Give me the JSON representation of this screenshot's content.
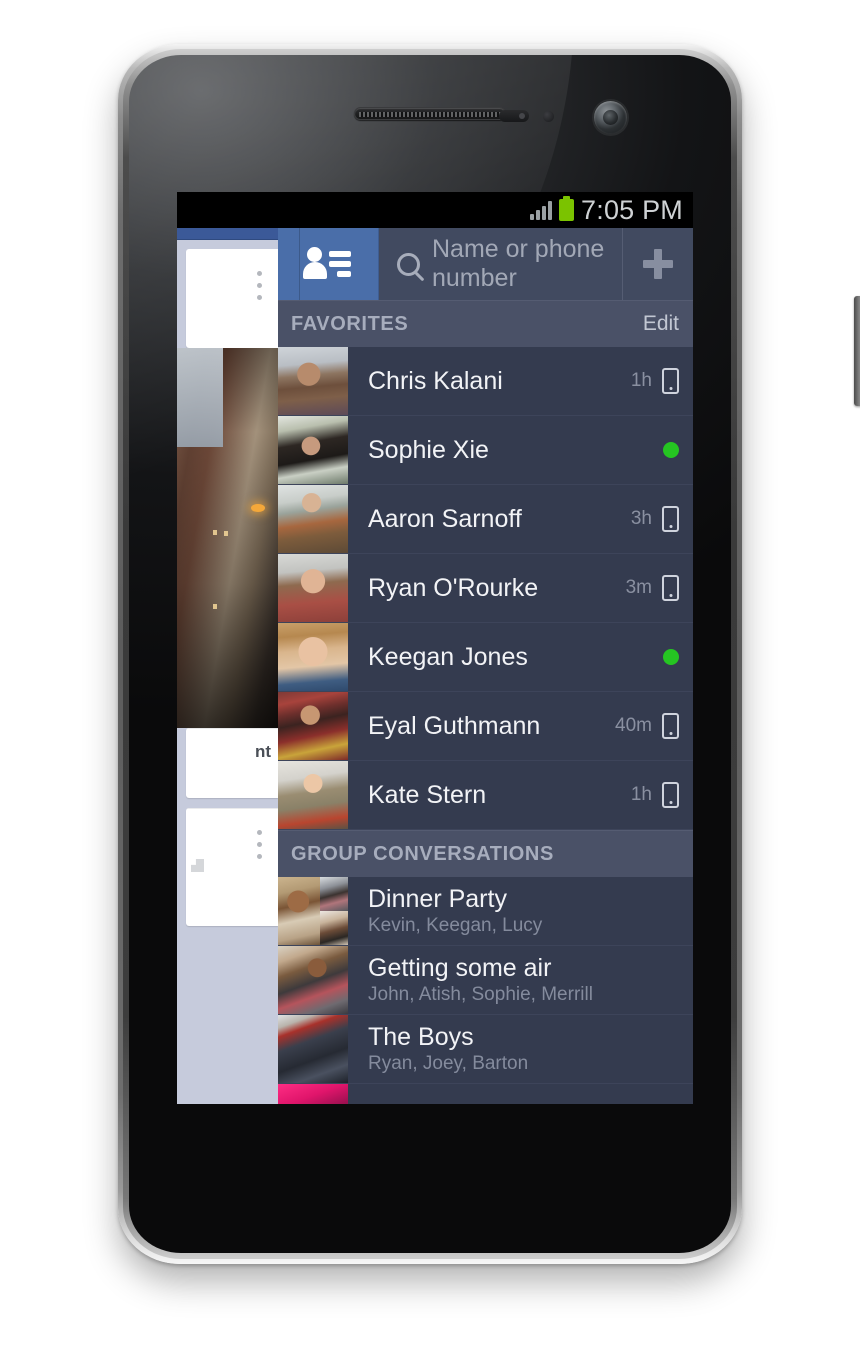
{
  "status_bar": {
    "time": "7:05 PM",
    "signal_icon": "signal-bars-icon",
    "battery_icon": "battery-full-icon",
    "battery_color": "#7bc300"
  },
  "header": {
    "contacts_icon": "contacts-list-icon",
    "search_icon": "search-icon",
    "search_placeholder": "Name or phone number",
    "search_value": "",
    "add_icon": "plus-icon",
    "accent_color": "#4a6ea9",
    "bar_color": "#414a60"
  },
  "sections": [
    {
      "title": "FAVORITES",
      "action_label": "Edit",
      "rows": [
        {
          "name": "Chris Kalani",
          "time": "1h",
          "status_icon": "mobile-icon",
          "avatar": "p-chris"
        },
        {
          "name": "Sophie Xie",
          "time": "",
          "status_icon": "online-dot",
          "avatar": "p-sophie"
        },
        {
          "name": "Aaron Sarnoff",
          "time": "3h",
          "status_icon": "mobile-icon",
          "avatar": "p-aaron"
        },
        {
          "name": "Ryan O'Rourke",
          "time": "3m",
          "status_icon": "mobile-icon",
          "avatar": "p-ryan"
        },
        {
          "name": "Keegan Jones",
          "time": "",
          "status_icon": "online-dot",
          "avatar": "p-keegan"
        },
        {
          "name": "Eyal Guthmann",
          "time": "40m",
          "status_icon": "mobile-icon",
          "avatar": "p-eyal"
        },
        {
          "name": "Kate Stern",
          "time": "1h",
          "status_icon": "mobile-icon",
          "avatar": "p-kate"
        }
      ]
    },
    {
      "title": "GROUP CONVERSATIONS",
      "action_label": "",
      "groups": [
        {
          "title": "Dinner Party",
          "members": "Kevin, Keegan, Lucy"
        },
        {
          "title": "Getting some air",
          "members": "John, Atish, Sophie, Merrill"
        },
        {
          "title": "The Boys",
          "members": "Ryan, Joey, Barton"
        },
        {
          "title": "",
          "members": ""
        }
      ]
    }
  ],
  "background_app": {
    "comment_label": "nt",
    "menu_icon": "overflow-menu-icon"
  },
  "device": {
    "speaker_icon": "earpiece-speaker",
    "front_camera_icon": "front-camera",
    "power_button": "power-button",
    "volume_button": "volume-rocker"
  },
  "colors": {
    "drawer_bg": "#343b4f",
    "section_bg": "#4a5167",
    "online_green": "#25c522",
    "facebook_blue": "#3b5998"
  }
}
